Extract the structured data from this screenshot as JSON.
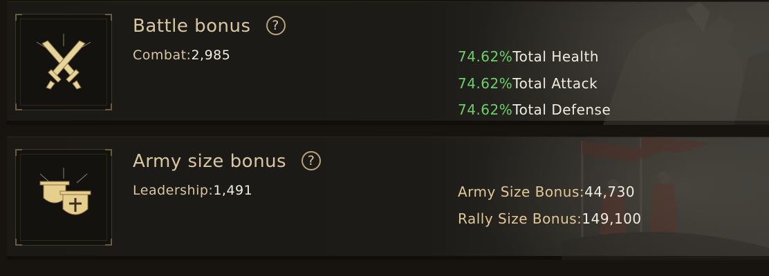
{
  "battle": {
    "title": "Battle bonus",
    "help": "?",
    "combat_label": "Combat:",
    "combat_value": "2,985",
    "bonuses": [
      {
        "pct": "74.62%",
        "label": "Total Health"
      },
      {
        "pct": "74.62%",
        "label": "Total Attack"
      },
      {
        "pct": "74.62%",
        "label": "Total Defense"
      }
    ]
  },
  "army": {
    "title": "Army size bonus",
    "help": "?",
    "leadership_label": "Leadership:",
    "leadership_value": "1,491",
    "bonuses": [
      {
        "label": "Army Size Bonus:",
        "value": "44,730"
      },
      {
        "label": "Rally Size Bonus:",
        "value": "149,100"
      }
    ]
  },
  "colors": {
    "accent_gold": "#d8c7a2",
    "percent_green": "#6fcf6a",
    "value_white": "#f1ece0"
  },
  "icons": {
    "battle": "crossed-swords-icon",
    "army": "banner-shield-icon",
    "help": "question-circle-icon"
  }
}
